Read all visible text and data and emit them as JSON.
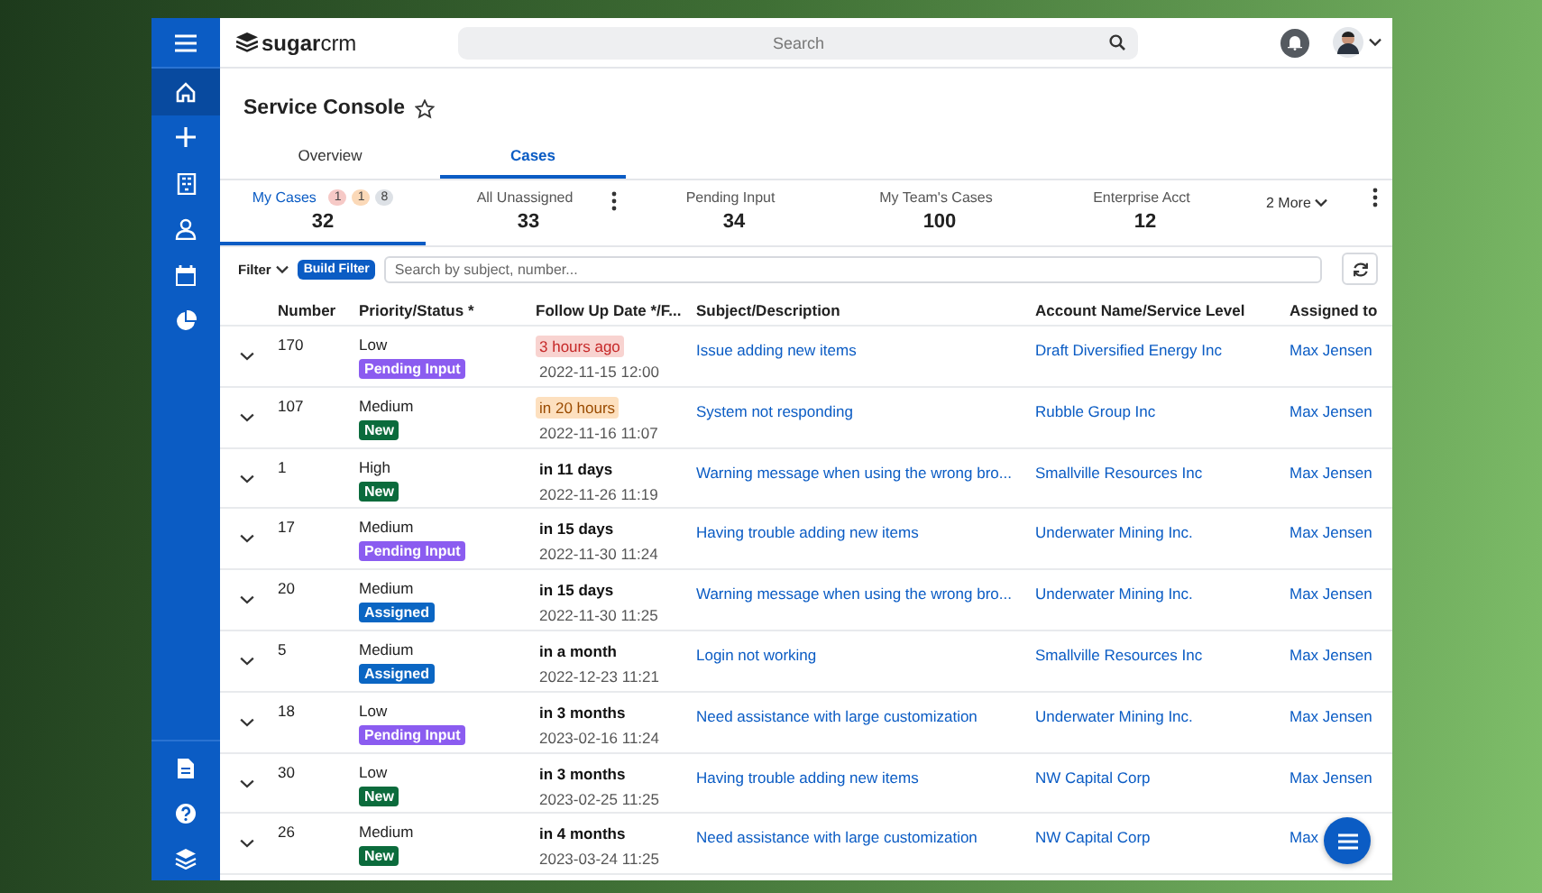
{
  "sidebar": {
    "items": [
      {
        "kind": "home",
        "selected": true
      },
      {
        "kind": "plus",
        "selected": false
      },
      {
        "kind": "building",
        "selected": false
      },
      {
        "kind": "person",
        "selected": false
      },
      {
        "kind": "calendar",
        "selected": false
      },
      {
        "kind": "chart",
        "selected": false
      }
    ],
    "bottom_items": [
      {
        "kind": "document",
        "selected": false
      },
      {
        "kind": "help",
        "selected": false
      },
      {
        "kind": "layers",
        "selected": false
      }
    ]
  },
  "top_bar": {
    "logo": {
      "bold": "sugar",
      "light": "crm"
    },
    "search": {
      "placeholder": "Search"
    }
  },
  "page_title": "Service Console",
  "tabs": [
    {
      "label": "Overview",
      "selected": false
    },
    {
      "label": "Cases",
      "selected": true
    }
  ],
  "subtabs": [
    {
      "label": "My Cases",
      "count": "32",
      "selected": true,
      "badges": [
        {
          "text": "1",
          "color": "#f6c9c6"
        },
        {
          "text": "1",
          "color": "#fbd9b8"
        },
        {
          "text": "8",
          "color": "#dde1e6"
        }
      ],
      "menu": false
    },
    {
      "label": "All Unassigned",
      "count": "33",
      "selected": false,
      "menu": true
    },
    {
      "label": "Pending Input",
      "count": "34",
      "selected": false,
      "menu": false
    },
    {
      "label": "My Team's Cases",
      "count": "100",
      "selected": false,
      "menu": false
    },
    {
      "label": "Enterprise Acct",
      "count": "12",
      "selected": false,
      "menu": false
    }
  ],
  "more_tabs": "2 More",
  "filter": {
    "label": "Filter",
    "build_button": "Build Filter",
    "search": {
      "placeholder": "Search by subject, number..."
    }
  },
  "table": {
    "columns": [
      "Number",
      "Priority/Status *",
      "Follow Up Date */F...",
      "Subject/Description",
      "Account Name/Service Level",
      "Assigned to"
    ],
    "rows": [
      {
        "number": "170",
        "priority": "Low",
        "status": "Pending Input",
        "color": "#8b5cf0",
        "due": "3 hours ago",
        "kind": "overdue",
        "date": "2022-11-15 12:00",
        "subject": "Issue adding new items",
        "account": "Draft Diversified Energy Inc",
        "assigned": "Max Jensen"
      },
      {
        "number": "107",
        "priority": "Medium",
        "status": "New",
        "color": "#0b6b3c",
        "due": "in 20 hours",
        "kind": "soon",
        "date": "2022-11-16 11:07",
        "subject": "System not responding",
        "account": "Rubble Group Inc",
        "assigned": "Max Jensen"
      },
      {
        "number": "1",
        "priority": "High",
        "status": "New",
        "color": "#0b6b3c",
        "due": "in 11 days",
        "kind": "later",
        "date": "2022-11-26 11:19",
        "subject": "Warning message when using the wrong bro...",
        "account": "Smallville Resources Inc",
        "assigned": "Max Jensen"
      },
      {
        "number": "17",
        "priority": "Medium",
        "status": "Pending Input",
        "color": "#8b5cf0",
        "due": "in 15 days",
        "kind": "later",
        "date": "2022-11-30 11:24",
        "subject": "Having trouble adding new items",
        "account": "Underwater Mining Inc.",
        "assigned": "Max Jensen"
      },
      {
        "number": "20",
        "priority": "Medium",
        "status": "Assigned",
        "color": "#0b66c3",
        "due": "in 15 days",
        "kind": "later",
        "date": "2022-11-30 11:25",
        "subject": "Warning message when using the wrong bro...",
        "account": "Underwater Mining Inc.",
        "assigned": "Max Jensen"
      },
      {
        "number": "5",
        "priority": "Medium",
        "status": "Assigned",
        "color": "#0b66c3",
        "due": "in a month",
        "kind": "later",
        "date": "2022-12-23 11:21",
        "subject": "Login not working",
        "account": "Smallville Resources Inc",
        "assigned": "Max Jensen"
      },
      {
        "number": "18",
        "priority": "Low",
        "status": "Pending Input",
        "color": "#8b5cf0",
        "due": "in 3 months",
        "kind": "later",
        "date": "2023-02-16 11:24",
        "subject": "Need assistance with large customization",
        "account": "Underwater Mining Inc.",
        "assigned": "Max Jensen"
      },
      {
        "number": "30",
        "priority": "Low",
        "status": "New",
        "color": "#0b6b3c",
        "due": "in 3 months",
        "kind": "later",
        "date": "2023-02-25 11:25",
        "subject": "Having trouble adding new items",
        "account": "NW Capital Corp",
        "assigned": "Max Jensen"
      },
      {
        "number": "26",
        "priority": "Medium",
        "status": "New",
        "color": "#0b6b3c",
        "due": "in 4 months",
        "kind": "later",
        "date": "2023-03-24 11:25",
        "subject": "Need assistance with large customization",
        "account": "NW Capital Corp",
        "assigned": "Max"
      }
    ]
  }
}
